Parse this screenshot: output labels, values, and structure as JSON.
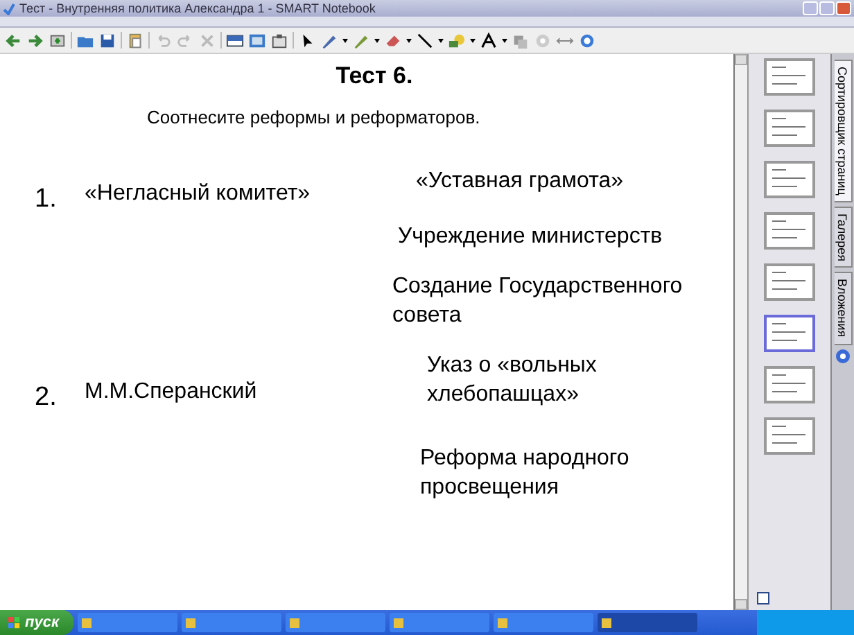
{
  "window": {
    "title": "Тест - Внутренняя политика Александра 1 - SMART Notebook"
  },
  "slide": {
    "title": "Тест 6.",
    "instruction": "Соотнесите реформы и реформаторов.",
    "reformers": [
      {
        "number": "1.",
        "name": "«Негласный комитет»"
      },
      {
        "number": "2.",
        "name": "М.М.Сперанский"
      }
    ],
    "reforms": [
      "«Уставная грамота»",
      "Учреждение министерств",
      "Создание Государственного совета",
      "Указ о «вольных хлебопашцах»",
      "Реформа народного просвещения"
    ]
  },
  "sidebar": {
    "thumbnails": [
      {
        "selected": false
      },
      {
        "selected": false
      },
      {
        "selected": false
      },
      {
        "selected": false
      },
      {
        "selected": false
      },
      {
        "selected": true
      },
      {
        "selected": false
      },
      {
        "selected": false
      }
    ],
    "tabs": [
      {
        "label": "Сортировщик страниц",
        "selected": true
      },
      {
        "label": "Галерея",
        "selected": false
      },
      {
        "label": "Вложения",
        "selected": false
      }
    ],
    "auto_hide": {
      "checked": false
    }
  },
  "taskbar": {
    "start": "пуск",
    "buttons": [
      {
        "selected": false
      },
      {
        "selected": false
      },
      {
        "selected": false
      },
      {
        "selected": false
      },
      {
        "selected": false
      },
      {
        "selected": true
      }
    ]
  }
}
